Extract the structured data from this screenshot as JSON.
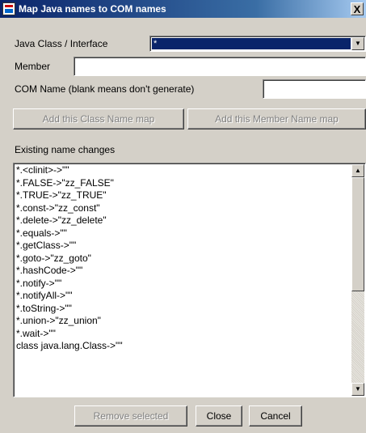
{
  "window": {
    "title": "Map Java names to COM names",
    "close_glyph": "X"
  },
  "java_class": {
    "label": "Java Class / Interface",
    "selected": "*"
  },
  "member": {
    "label": "Member",
    "value": ""
  },
  "com_name": {
    "label": "COM Name (blank means don't generate)",
    "value": ""
  },
  "buttons": {
    "add_class": "Add this Class Name map",
    "add_member": "Add this Member Name map",
    "remove_selected": "Remove selected",
    "close": "Close",
    "cancel": "Cancel"
  },
  "existing": {
    "label": "Existing name changes",
    "items": [
      "*.<clinit>->\"\"",
      "*.FALSE->\"zz_FALSE\"",
      "*.TRUE->\"zz_TRUE\"",
      "*.const->\"zz_const\"",
      "*.delete->\"zz_delete\"",
      "*.equals->\"\"",
      "*.getClass->\"\"",
      "*.goto->\"zz_goto\"",
      "*.hashCode->\"\"",
      "*.notify->\"\"",
      "*.notifyAll->\"\"",
      "*.toString->\"\"",
      "*.union->\"zz_union\"",
      "*.wait->\"\"",
      "class java.lang.Class->\"\""
    ],
    "scroll_thumb_fraction": 0.55
  },
  "icons": {
    "app": "app-icon",
    "combo_arrow": "chevron-down-icon",
    "scroll_up": "arrow-up-icon",
    "scroll_down": "arrow-down-icon"
  },
  "colors": {
    "title_bar_start": "#0a246a",
    "title_bar_end": "#a6caf0",
    "window_bg": "#d4d0c8",
    "selection": "#0a246a"
  }
}
